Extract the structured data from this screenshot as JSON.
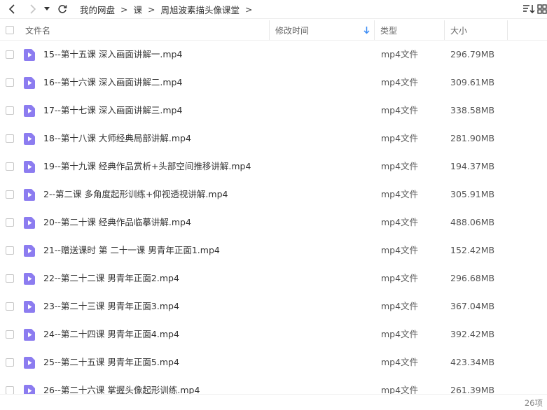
{
  "toolbar": {
    "breadcrumbs": [
      "我的网盘",
      "课",
      "周旭波素描头像课堂"
    ]
  },
  "table": {
    "headers": {
      "name": "文件名",
      "modified": "修改时间",
      "type": "类型",
      "size": "大小"
    },
    "rows": [
      {
        "name": "15--第十五课 深入画面讲解一.mp4",
        "type": "mp4文件",
        "size": "296.79MB"
      },
      {
        "name": "16--第十六课 深入画面讲解二.mp4",
        "type": "mp4文件",
        "size": "309.61MB"
      },
      {
        "name": "17--第十七课 深入画面讲解三.mp4",
        "type": "mp4文件",
        "size": "338.58MB"
      },
      {
        "name": "18--第十八课 大师经典局部讲解.mp4",
        "type": "mp4文件",
        "size": "281.90MB"
      },
      {
        "name": "19--第十九课 经典作品赏析+头部空间推移讲解.mp4",
        "type": "mp4文件",
        "size": "194.37MB"
      },
      {
        "name": "2--第二课 多角度起形训练+仰视透视讲解.mp4",
        "type": "mp4文件",
        "size": "305.91MB"
      },
      {
        "name": "20--第二十课 经典作品临摹讲解.mp4",
        "type": "mp4文件",
        "size": "488.06MB"
      },
      {
        "name": "21--赠送课时 第 二十一课 男青年正面1.mp4",
        "type": "mp4文件",
        "size": "152.42MB"
      },
      {
        "name": "22--第二十二课 男青年正面2.mp4",
        "type": "mp4文件",
        "size": "296.68MB"
      },
      {
        "name": "23--第二十三课 男青年正面3.mp4",
        "type": "mp4文件",
        "size": "367.04MB"
      },
      {
        "name": "24--第二十四课 男青年正面4.mp4",
        "type": "mp4文件",
        "size": "392.42MB"
      },
      {
        "name": "25--第二十五课 男青年正面5.mp4",
        "type": "mp4文件",
        "size": "423.34MB"
      },
      {
        "name": "26--第二十六课 掌握头像起形训练.mp4",
        "type": "mp4文件",
        "size": "261.39MB"
      }
    ]
  },
  "status": {
    "count": "26项"
  },
  "colors": {
    "video_icon": "#8c7cf0",
    "sort_arrow": "#3b8cf5"
  }
}
